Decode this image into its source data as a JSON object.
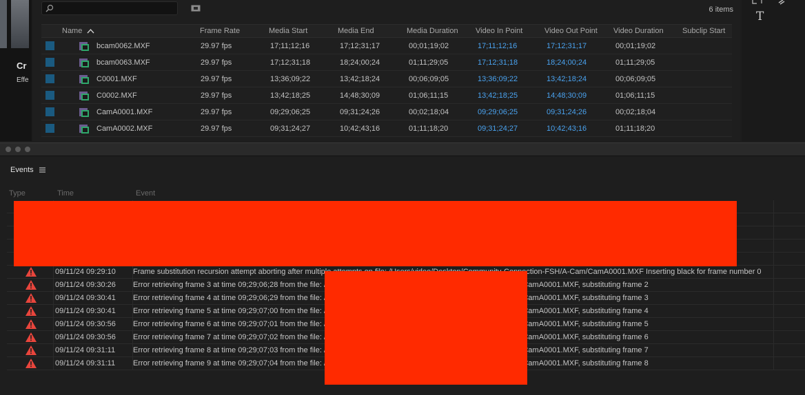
{
  "left": {
    "title": "Cr",
    "subtitle": "Effe"
  },
  "project": {
    "items_count": "6 items",
    "columns": [
      "Name",
      "Frame Rate",
      "Media Start",
      "Media End",
      "Media Duration",
      "Video In Point",
      "Video Out Point",
      "Video Duration",
      "Subclip Start"
    ],
    "rows": [
      {
        "name": "bcam0062.MXF",
        "fps": "29.97 fps",
        "mstart": "17;11;12;16",
        "mend": "17;12;31;17",
        "mdur": "00;01;19;02",
        "vin": "17;11;12;16",
        "vout": "17;12;31;17",
        "vdur": "00;01;19;02"
      },
      {
        "name": "bcam0063.MXF",
        "fps": "29.97 fps",
        "mstart": "17;12;31;18",
        "mend": "18;24;00;24",
        "mdur": "01;11;29;05",
        "vin": "17;12;31;18",
        "vout": "18;24;00;24",
        "vdur": "01;11;29;05"
      },
      {
        "name": "C0001.MXF",
        "fps": "29.97 fps",
        "mstart": "13;36;09;22",
        "mend": "13;42;18;24",
        "mdur": "00;06;09;05",
        "vin": "13;36;09;22",
        "vout": "13;42;18;24",
        "vdur": "00;06;09;05"
      },
      {
        "name": "C0002.MXF",
        "fps": "29.97 fps",
        "mstart": "13;42;18;25",
        "mend": "14;48;30;09",
        "mdur": "01;06;11;15",
        "vin": "13;42;18;25",
        "vout": "14;48;30;09",
        "vdur": "01;06;11;15"
      },
      {
        "name": "CamA0001.MXF",
        "fps": "29.97 fps",
        "mstart": "09;29;06;25",
        "mend": "09;31;24;26",
        "mdur": "00;02;18;04",
        "vin": "09;29;06;25",
        "vout": "09;31;24;26",
        "vdur": "00;02;18;04"
      },
      {
        "name": "CamA0002.MXF",
        "fps": "29.97 fps",
        "mstart": "09;31;24;27",
        "mend": "10;42;43;16",
        "mdur": "01;11;18;20",
        "vin": "09;31;24;27",
        "vout": "10;42;43;16",
        "vdur": "01;11;18;20"
      }
    ],
    "swatch_color": "#1a5a80",
    "timecode_color": "#4aa3f0"
  },
  "tools": {
    "type_tool": "T"
  },
  "events": {
    "title": "Events",
    "columns": {
      "type": "Type",
      "time": "Time",
      "event": "Event"
    },
    "rows": [
      {
        "time": "09/11/24 09:29:10",
        "text": "Frame substitution recursion attempt aborting after multiple attempts on file: /Users/video/Desktop/Community-Connection-FSH/A-Cam/CamA0001.MXF  Inserting black for frame number 0"
      },
      {
        "time": "09/11/24 09:30:26",
        "text": "Error retrieving frame 3 at time 09;29;06;28 from the file: /Users/video/Desktop/Community-Connection-FSH/A-Cam/CamA0001.MXF, substituting frame 2"
      },
      {
        "time": "09/11/24 09:30:41",
        "text": "Error retrieving frame 4 at time 09;29;06;29 from the file: /Users/video/Desktop/Community-Connection-FSH/A-Cam/CamA0001.MXF, substituting frame 3"
      },
      {
        "time": "09/11/24 09:30:41",
        "text": "Error retrieving frame 5 at time 09;29;07;00 from the file: /Users/video/Desktop/Community-Connection-FSH/A-Cam/CamA0001.MXF, substituting frame 4"
      },
      {
        "time": "09/11/24 09:30:56",
        "text": "Error retrieving frame 6 at time 09;29;07;01 from the file: /Users/video/Desktop/Community-Connection-FSH/A-Cam/CamA0001.MXF, substituting frame 5"
      },
      {
        "time": "09/11/24 09:30:56",
        "text": "Error retrieving frame 7 at time 09;29;07;02 from the file: /Users/video/Desktop/Community-Connection-FSH/A-Cam/CamA0001.MXF, substituting frame 6"
      },
      {
        "time": "09/11/24 09:31:11",
        "text": "Error retrieving frame 8 at time 09;29;07;03 from the file: /Users/video/Desktop/Community-Connection-FSH/A-Cam/CamA0001.MXF, substituting frame 7"
      },
      {
        "time": "09/11/24 09:31:11",
        "text": "Error retrieving frame 9 at time 09;29;07;04 from the file: /Users/video/Desktop/Community-Connection-FSH/A-Cam/CamA0001.MXF, substituting frame 8"
      }
    ],
    "warning_color": "#e8453c",
    "redaction_color": "#ff2a00"
  }
}
